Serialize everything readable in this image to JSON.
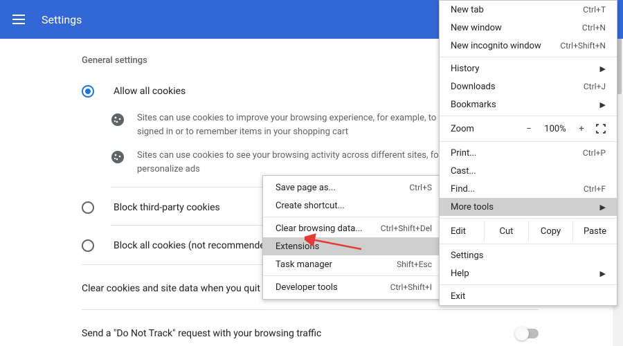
{
  "topbar": {
    "title": "Settings"
  },
  "section": {
    "title": "General settings"
  },
  "cookies": {
    "options": [
      {
        "label": "Allow all cookies",
        "checked": true
      },
      {
        "label": "Block third-party cookies",
        "checked": false
      },
      {
        "label": "Block all cookies (not recommended)",
        "checked": false
      }
    ],
    "desc1": "Sites can use cookies to improve your browsing experience, for example, to keep you signed in or to remember items in your shopping cart",
    "desc2": "Sites can use cookies to see your browsing activity across different sites, for example, to personalize ads"
  },
  "toggles": {
    "clear_on_exit": "Clear cookies and site data when you quit Chrome",
    "do_not_track": "Send a \"Do Not Track\" request with your browsing traffic"
  },
  "menu": {
    "new_tab": {
      "label": "New tab",
      "shortcut": "Ctrl+T"
    },
    "new_win": {
      "label": "New window",
      "shortcut": "Ctrl+N"
    },
    "incognito": {
      "label": "New incognito window",
      "shortcut": "Ctrl+Shift+N"
    },
    "history": {
      "label": "History"
    },
    "downloads": {
      "label": "Downloads",
      "shortcut": "Ctrl+J"
    },
    "bookmarks": {
      "label": "Bookmarks"
    },
    "zoom_label": "Zoom",
    "zoom_value": "100%",
    "print": {
      "label": "Print...",
      "shortcut": "Ctrl+P"
    },
    "cast": {
      "label": "Cast..."
    },
    "find": {
      "label": "Find...",
      "shortcut": "Ctrl+F"
    },
    "more_tools": {
      "label": "More tools"
    },
    "edit_label": "Edit",
    "cut": "Cut",
    "copy": "Copy",
    "paste": "Paste",
    "settings": {
      "label": "Settings"
    },
    "help": {
      "label": "Help"
    },
    "exit": {
      "label": "Exit"
    }
  },
  "submenu": {
    "save_page": {
      "label": "Save page as...",
      "shortcut": "Ctrl+S"
    },
    "create_sc": {
      "label": "Create shortcut..."
    },
    "clear_data": {
      "label": "Clear browsing data...",
      "shortcut": "Ctrl+Shift+Del"
    },
    "extensions": {
      "label": "Extensions"
    },
    "task_mgr": {
      "label": "Task manager",
      "shortcut": "Shift+Esc"
    },
    "dev_tools": {
      "label": "Developer tools",
      "shortcut": "Ctrl+Shift+I"
    }
  }
}
